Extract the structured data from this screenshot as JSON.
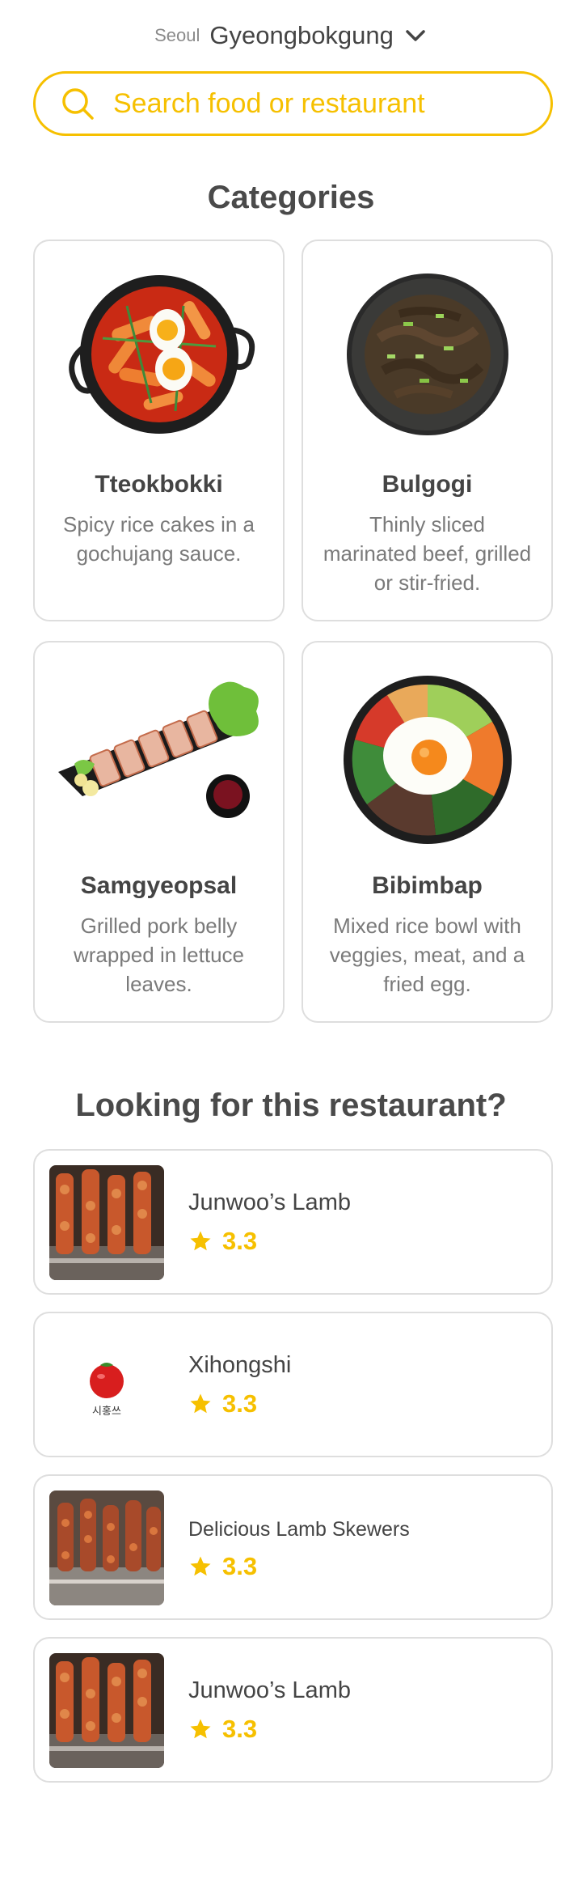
{
  "location": {
    "city": "Seoul",
    "area": "Gyeongbokgung"
  },
  "search": {
    "placeholder": "Search food or restaurant"
  },
  "categories_section": {
    "title": "Categories",
    "items": [
      {
        "name": "Tteokbokki",
        "desc": "Spicy rice cakes in a gochujang sauce."
      },
      {
        "name": "Bulgogi",
        "desc": "Thinly sliced marinated beef, grilled or stir-fried."
      },
      {
        "name": "Samgyeopsal",
        "desc": "Grilled pork belly wrapped in lettuce leaves."
      },
      {
        "name": "Bibimbap",
        "desc": "Mixed rice bowl with veggies, meat, and a fried egg."
      }
    ]
  },
  "restaurants_section": {
    "title": "Looking for this restaurant?",
    "items": [
      {
        "name": "Junwoo’s Lamb",
        "rating": "3.3"
      },
      {
        "name": "Xihongshi",
        "rating": "3.3",
        "logo_text": "시홍쓰"
      },
      {
        "name": "Delicious Lamb Skewers",
        "rating": "3.3"
      },
      {
        "name": "Junwoo’s Lamb",
        "rating": "3.3"
      }
    ]
  },
  "colors": {
    "accent": "#f6c000",
    "border": "#dedede",
    "text": "#4a4a4a",
    "muted": "#7a7a7a"
  }
}
